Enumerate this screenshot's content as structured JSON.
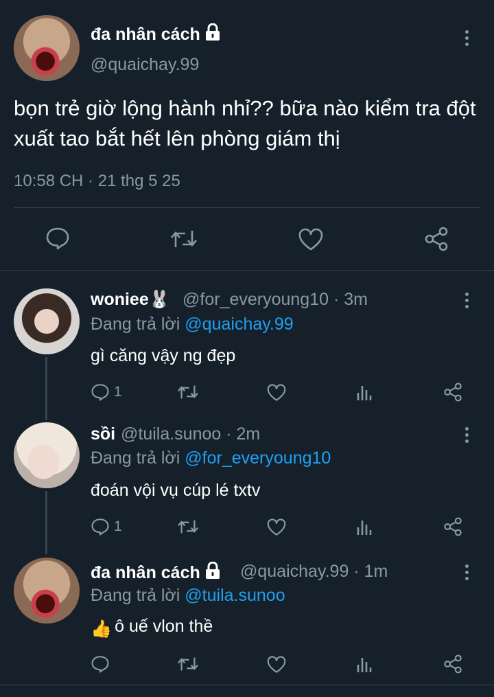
{
  "main_tweet": {
    "display_name": "đa nhân cách",
    "handle": "@quaichay.99",
    "text": "bọn trẻ giờ lộng hành nhỉ?? bữa nào kiểm tra đột xuất tao bắt hết lên phòng giám thị",
    "timestamp": "10:58 CH · 21 thg 5 25",
    "actions": [
      "reply-icon",
      "retweet-icon",
      "like-icon",
      "share-icon"
    ]
  },
  "replies": [
    {
      "display_name": "woniee",
      "name_emoji": "🐰",
      "handle": "@for_everyoung10",
      "time": "3m",
      "replying_prefix": "Đang trả lời",
      "replying_to": "@quaichay.99",
      "text": "gì căng vậy ng đẹp",
      "reply_count": "1"
    },
    {
      "display_name": "sồi",
      "handle": "@tuila.sunoo",
      "time": "2m",
      "replying_prefix": "Đang trả lời",
      "replying_to": "@for_everyoung10",
      "text": "đoán vội vụ cúp lé txtv",
      "reply_count": "1"
    },
    {
      "display_name": "đa nhân cách",
      "handle": "@quaichay.99",
      "time": "1m",
      "replying_prefix": "Đang trả lời",
      "replying_to": "@tuila.sunoo",
      "text": "ô uế vlon thề",
      "text_emoji": "👍",
      "reply_count": ""
    }
  ],
  "colors": {
    "background": "#15202b",
    "secondary_text": "#8899a6",
    "mention": "#1da1f2",
    "divider": "#38444d"
  }
}
